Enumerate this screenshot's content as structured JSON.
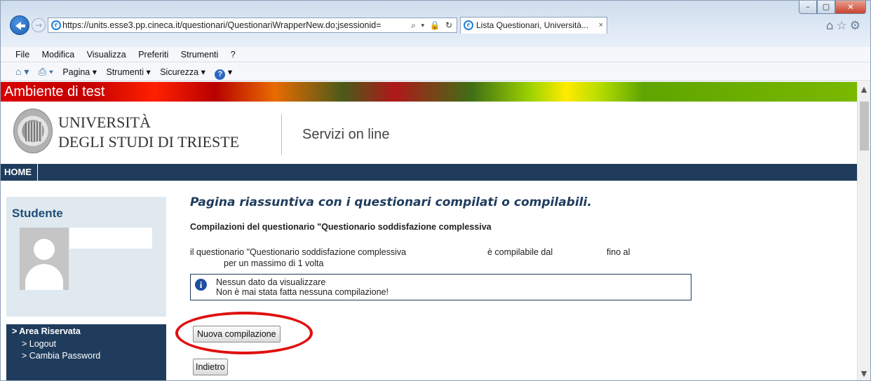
{
  "browser": {
    "url": "https://units.esse3.pp.cineca.it/questionari/QuestionariWrapperNew.do;jsessionid=",
    "url_tools": "⌕ ▾ 🔒 ↻",
    "tab_title": "Lista Questionari, Università...",
    "tab_close": "×",
    "forward_glyph": "→",
    "win_minimize": "–",
    "win_maximize": "▢",
    "win_close": "×",
    "right_icons": "⌂☆⚙"
  },
  "menu": [
    "File",
    "Modifica",
    "Visualizza",
    "Preferiti",
    "Strumenti",
    "?"
  ],
  "command_bar": {
    "home_glyph": "⌂ ▾",
    "print_glyph": "⎙ ▾",
    "items": [
      "Pagina ▾",
      "Strumenti ▾",
      "Sicurezza ▾"
    ],
    "help_glyph": "?",
    "help_arrow": "▾"
  },
  "header": {
    "test_label": "Ambiente di test",
    "university_line1": "UNIVERSITÀ",
    "university_line2": "DEGLI STUDI DI TRIESTE",
    "services": "Servizi on line",
    "nav_home": "HOME"
  },
  "sidebar": {
    "title": "Studente",
    "area_title": "> Area Riservata",
    "items": [
      "> Logout",
      "> Cambia Password"
    ]
  },
  "main": {
    "title": "Pagina riassuntiva con i questionari compilati o compilabili.",
    "subtitle": "Compilazioni del questionario \"Questionario soddisfazione complessiva",
    "q_text": "il questionario \"Questionario soddisfazione complessiva",
    "q_from": "è compilabile dal",
    "q_to": "fino al",
    "q_max": "per un massimo di 1 volta",
    "info_glyph": "i",
    "msg_line1": "Nessun dato da visualizzare",
    "msg_line2": "Non è mai stata fatta nessuna compilazione!",
    "btn_new": "Nuova compilazione",
    "btn_back": "Indietro"
  },
  "scrollbar": {
    "up": "▲",
    "down": "▼"
  },
  "colors": {
    "nav": "#1f3c5c",
    "highlight": "#e01010",
    "sidebar_bg": "#dfe9ef"
  }
}
